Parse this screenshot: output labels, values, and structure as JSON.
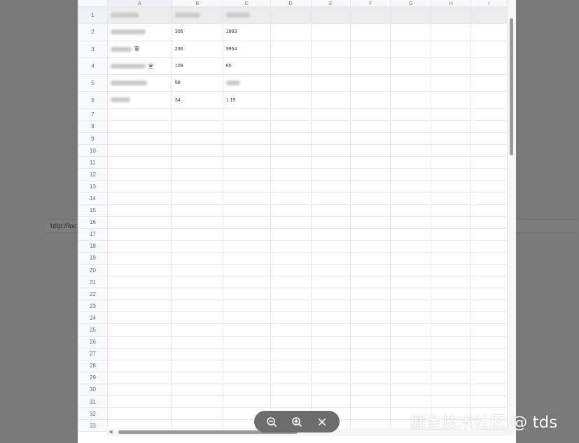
{
  "background": {
    "url_text": "http://loc"
  },
  "columns": [
    "",
    "A",
    "B",
    "C",
    "D",
    "E",
    "F",
    "G",
    "H",
    "I"
  ],
  "rows": [
    {
      "num": "1",
      "cells": [
        "",
        "",
        "",
        "",
        "",
        "",
        "",
        "",
        ""
      ]
    },
    {
      "num": "2",
      "cells": [
        "",
        "306",
        "1863",
        "",
        "",
        "",
        "",
        "",
        ""
      ]
    },
    {
      "num": "3",
      "cells": [
        "室",
        "236",
        "9954",
        "",
        "",
        "",
        "",
        "",
        ""
      ]
    },
    {
      "num": "4",
      "cells": [
        "室",
        "109",
        "65",
        "",
        "",
        "",
        "",
        "",
        ""
      ]
    },
    {
      "num": "5",
      "cells": [
        "",
        "58",
        "",
        "",
        "",
        "",
        "",
        "",
        ""
      ]
    },
    {
      "num": "6",
      "cells": [
        "",
        "34",
        "1 19",
        "",
        "",
        "",
        "",
        "",
        ""
      ]
    }
  ],
  "empty_rows": [
    "7",
    "8",
    "9",
    "10",
    "11",
    "12",
    "13",
    "14",
    "15",
    "16",
    "17",
    "18",
    "19",
    "20",
    "21",
    "22",
    "23",
    "24",
    "25",
    "26",
    "27",
    "28",
    "29",
    "30",
    "31",
    "32",
    "33"
  ],
  "toolbar": {
    "zoom_out_icon": "zoom-out-icon",
    "zoom_in_icon": "zoom-in-icon",
    "close_icon": "close-icon"
  },
  "watermark": "掘金技术社区 @ tds",
  "colors": {
    "toolbar_bg": "#6c6c6c",
    "overlay_bg": "#7a7a7a",
    "grid_line": "#e3e6ea"
  }
}
